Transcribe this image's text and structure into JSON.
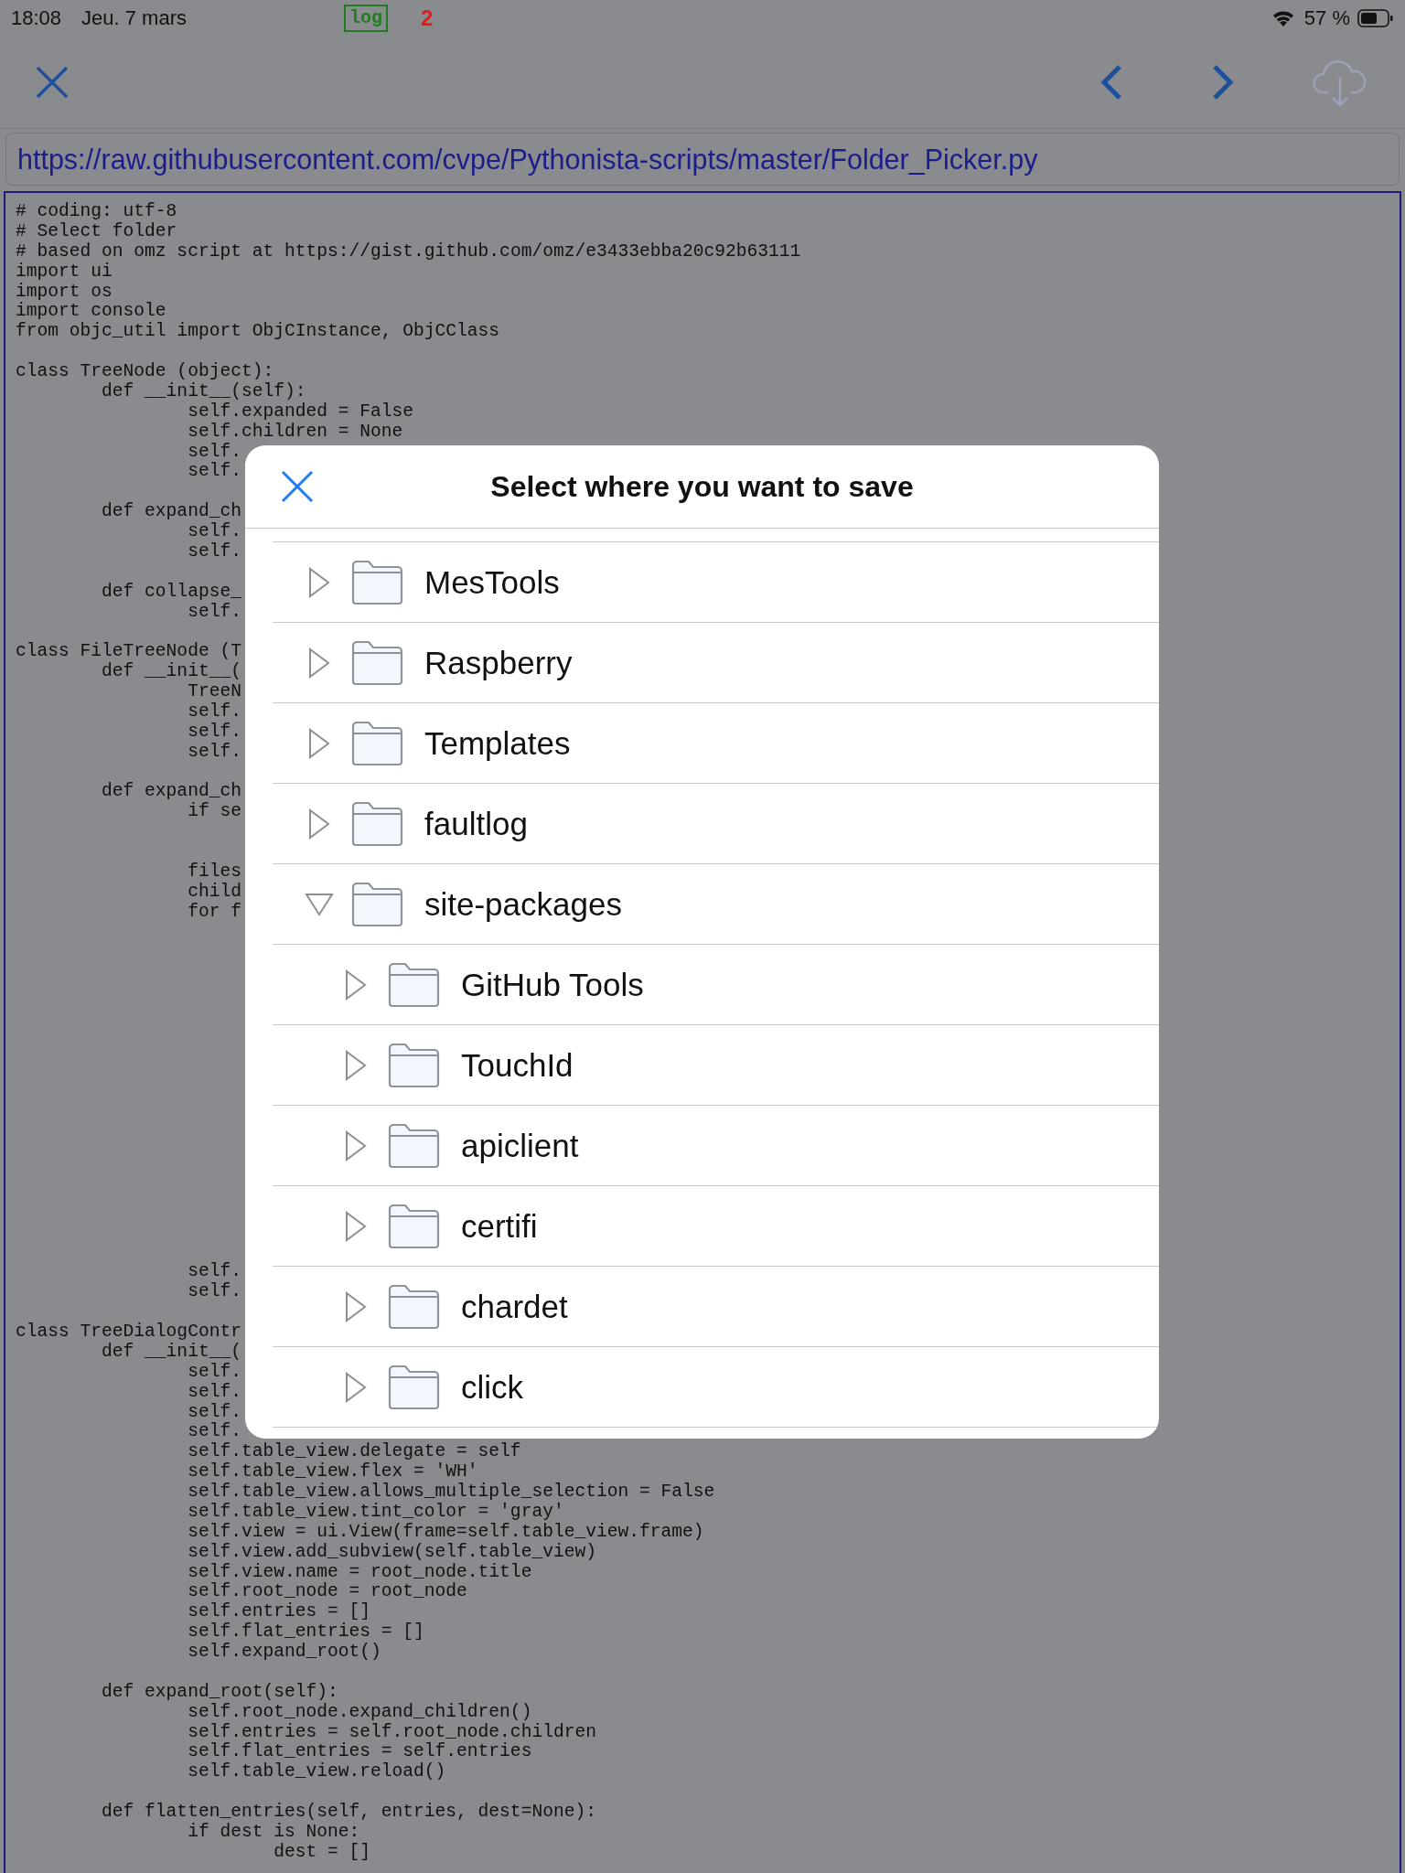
{
  "status_bar": {
    "time": "18:08",
    "date": "Jeu. 7 mars",
    "log_badge": "log",
    "count": "2",
    "battery": "57 %"
  },
  "toolbar": {
    "download": {
      "disabled": true
    }
  },
  "url_field": {
    "value": "https://raw.githubusercontent.com/cvpe/Pythonista-scripts/master/Folder_Picker.py"
  },
  "code": "# coding: utf-8\n# Select folder\n# based on omz script at https://gist.github.com/omz/e3433ebba20c92b63111\nimport ui\nimport os\nimport console\nfrom objc_util import ObjCInstance, ObjCClass\n\nclass TreeNode (object):\n        def __init__(self):\n                self.expanded = False\n                self.children = None\n                self.\n                self.\n\n        def expand_ch\n                self.\n                self.\n\n        def collapse_\n                self.\n\nclass FileTreeNode (T\n        def __init__(\n                TreeN\n                self.\n                self.\n                self.\n\n        def expand_ch\n                if se\n\n\n                files\n                child\n                for f\n\n\n\n\n\n\n\n\n\n\n\n\n\n\n\n\n\n                self.\n                self.\n\nclass TreeDialogContr\n        def __init__(\n                self.\n                self.\n                self.\n                self.\n                self.table_view.delegate = self\n                self.table_view.flex = 'WH'\n                self.table_view.allows_multiple_selection = False\n                self.table_view.tint_color = 'gray'\n                self.view = ui.View(frame=self.table_view.frame)\n                self.view.add_subview(self.table_view)\n                self.view.name = root_node.title\n                self.root_node = root_node\n                self.entries = []\n                self.flat_entries = []\n                self.expand_root()\n\n        def expand_root(self):\n                self.root_node.expand_children()\n                self.entries = self.root_node.children\n                self.flat_entries = self.entries\n                self.table_view.reload()\n\n        def flatten_entries(self, entries, dest=None):\n                if dest is None:\n                        dest = []",
  "dialog": {
    "title": "Select where you want to save",
    "folders": [
      {
        "name": "MesTools",
        "expanded": false
      },
      {
        "name": "Raspberry",
        "expanded": false
      },
      {
        "name": "Templates",
        "expanded": false
      },
      {
        "name": "faultlog",
        "expanded": false
      },
      {
        "name": "site-packages",
        "expanded": true,
        "children": [
          {
            "name": "GitHub Tools",
            "expanded": false
          },
          {
            "name": "TouchId",
            "expanded": false
          },
          {
            "name": "apiclient",
            "expanded": false
          },
          {
            "name": "certifi",
            "expanded": false
          },
          {
            "name": "chardet",
            "expanded": false
          },
          {
            "name": "click",
            "expanded": false
          }
        ]
      }
    ]
  }
}
